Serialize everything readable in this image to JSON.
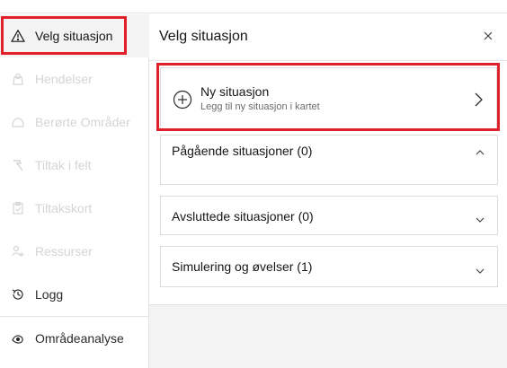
{
  "sidebar": {
    "items": [
      {
        "label": "Velg situasjon",
        "icon": "warning-icon",
        "state": "active"
      },
      {
        "label": "Hendelser",
        "icon": "map-pin-icon",
        "state": "disabled"
      },
      {
        "label": "Berørte Områder",
        "icon": "area-icon",
        "state": "disabled"
      },
      {
        "label": "Tiltak i felt",
        "icon": "hammer-icon",
        "state": "disabled"
      },
      {
        "label": "Tiltakskort",
        "icon": "clipboard-icon",
        "state": "disabled"
      },
      {
        "label": "Ressurser",
        "icon": "person-add-icon",
        "state": "disabled"
      },
      {
        "label": "Logg",
        "icon": "history-icon",
        "state": "normal"
      },
      {
        "label": "Områdeanalyse",
        "icon": "analysis-icon",
        "state": "normal"
      }
    ]
  },
  "panel": {
    "title": "Velg situasjon",
    "close_icon": "close-icon",
    "new_situation": {
      "title": "Ny situasjon",
      "subtitle": "Legg til ny situasjon i kartet"
    },
    "sections": [
      {
        "label": "Pågående situasjoner (0)",
        "expanded": true
      },
      {
        "label": "Avsluttede situasjoner (0)",
        "expanded": false
      },
      {
        "label": "Simulering og øvelser (1)",
        "expanded": false
      }
    ]
  },
  "colors": {
    "highlight": "#e0202a",
    "active_bg": "#f3f3f3",
    "disabled_text": "#d4d4d4"
  }
}
